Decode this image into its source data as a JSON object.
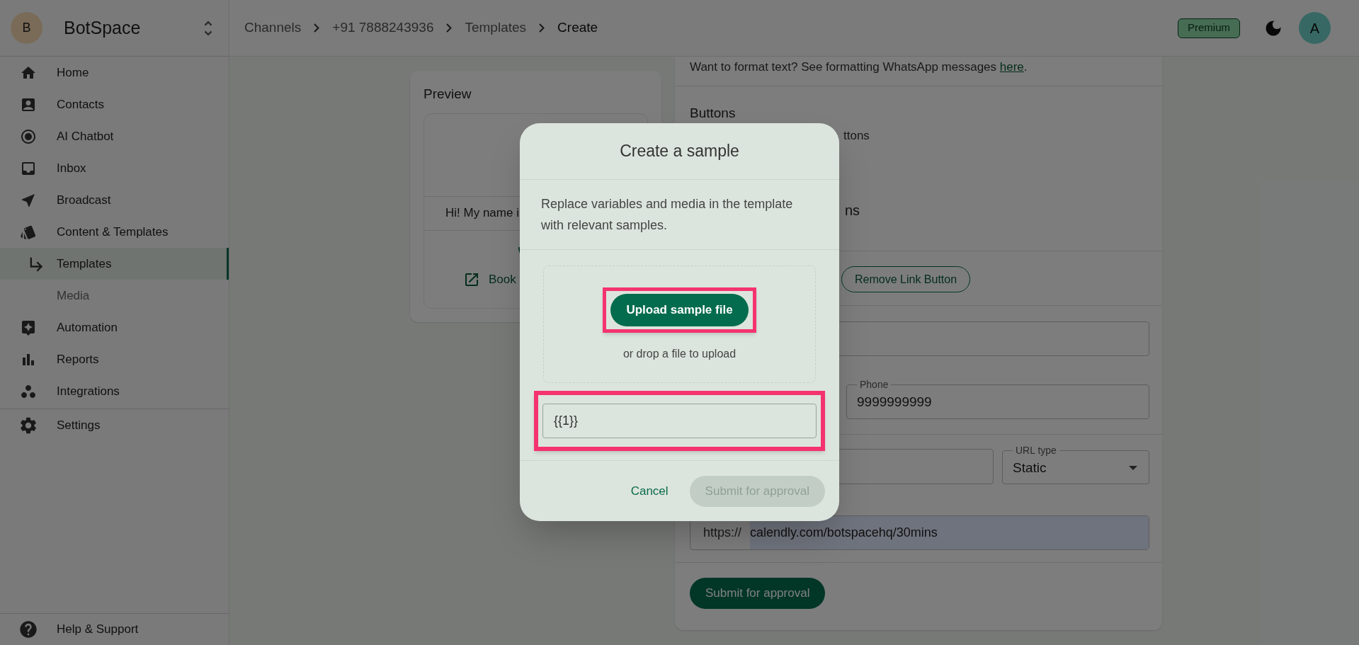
{
  "sidebar": {
    "workspace": {
      "initial": "B",
      "name": "BotSpace"
    },
    "items": [
      {
        "label": "Home",
        "kind": "item",
        "selected": false
      },
      {
        "label": "Contacts",
        "kind": "item",
        "selected": false
      },
      {
        "label": "AI Chatbot",
        "kind": "item",
        "selected": false
      },
      {
        "label": "Inbox",
        "kind": "item",
        "selected": false
      },
      {
        "label": "Broadcast",
        "kind": "item",
        "selected": false
      },
      {
        "label": "Content & Templates",
        "kind": "item",
        "selected": false
      },
      {
        "label": "Templates",
        "kind": "subitem",
        "selected": true
      },
      {
        "label": "Media",
        "kind": "plain",
        "selected": false
      },
      {
        "label": "Automation",
        "kind": "item",
        "selected": false
      },
      {
        "label": "Reports",
        "kind": "item",
        "selected": false
      },
      {
        "label": "Integrations",
        "kind": "item",
        "selected": false
      }
    ],
    "settings": "Settings",
    "help": "Help & Support"
  },
  "header": {
    "breadcrumbs": [
      "Channels",
      "+91 7888243936",
      "Templates",
      "Create"
    ],
    "plan_badge": "Premium",
    "user_initial": "A"
  },
  "preview": {
    "title": "Preview",
    "message": "Hi! My name i",
    "link": "Book"
  },
  "form": {
    "hint_text": "Want to format text? See formatting WhatsApp messages ",
    "hint_link": "here",
    "hint_end": ".",
    "buttons_heading": "Buttons",
    "buttons_partial": "ttons",
    "buttons_partial_2": "ns",
    "remove_button": "Remove Link Button",
    "phone": {
      "label": "Phone",
      "value": "9999999999"
    },
    "url_type": {
      "label": "URL type",
      "value": "Static"
    },
    "url": {
      "prefix": "https://",
      "value": "calendly.com/botspacehq/30mins"
    },
    "submit": "Submit for approval"
  },
  "modal": {
    "title": "Create a sample",
    "description": "Replace variables and media in the template with relevant samples.",
    "upload_button": "Upload sample file",
    "drop_hint": "or drop a file to upload",
    "sample_value": "{{1}}",
    "cancel": "Cancel",
    "submit": {
      "label": "Submit for approval",
      "disabled": true
    }
  }
}
